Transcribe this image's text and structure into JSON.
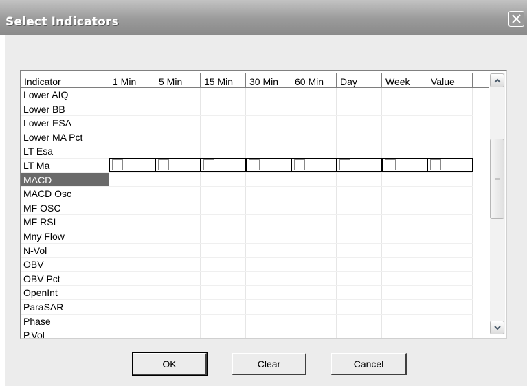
{
  "window": {
    "title": "Select Indicators"
  },
  "table": {
    "columns": [
      "Indicator",
      "1 Min",
      "5 Min",
      "15 Min",
      "30 Min",
      "60 Min",
      "Day",
      "Week",
      "Value"
    ],
    "rows": [
      "Lower AIQ",
      "Lower BB",
      "Lower ESA",
      "Lower MA Pct",
      "LT Esa",
      "LT Ma",
      "MACD",
      "MACD Osc",
      "MF OSC",
      "MF RSI",
      "Mny Flow",
      "N-Vol",
      "OBV",
      "OBV Pct",
      "OpenInt",
      "ParaSAR",
      "Phase",
      "P.Vol"
    ],
    "selected_row": "MACD",
    "checkboxes_checked": [
      false,
      false,
      false,
      false,
      false,
      false,
      false,
      false
    ]
  },
  "buttons": {
    "ok": "OK",
    "clear": "Clear",
    "cancel": "Cancel"
  }
}
